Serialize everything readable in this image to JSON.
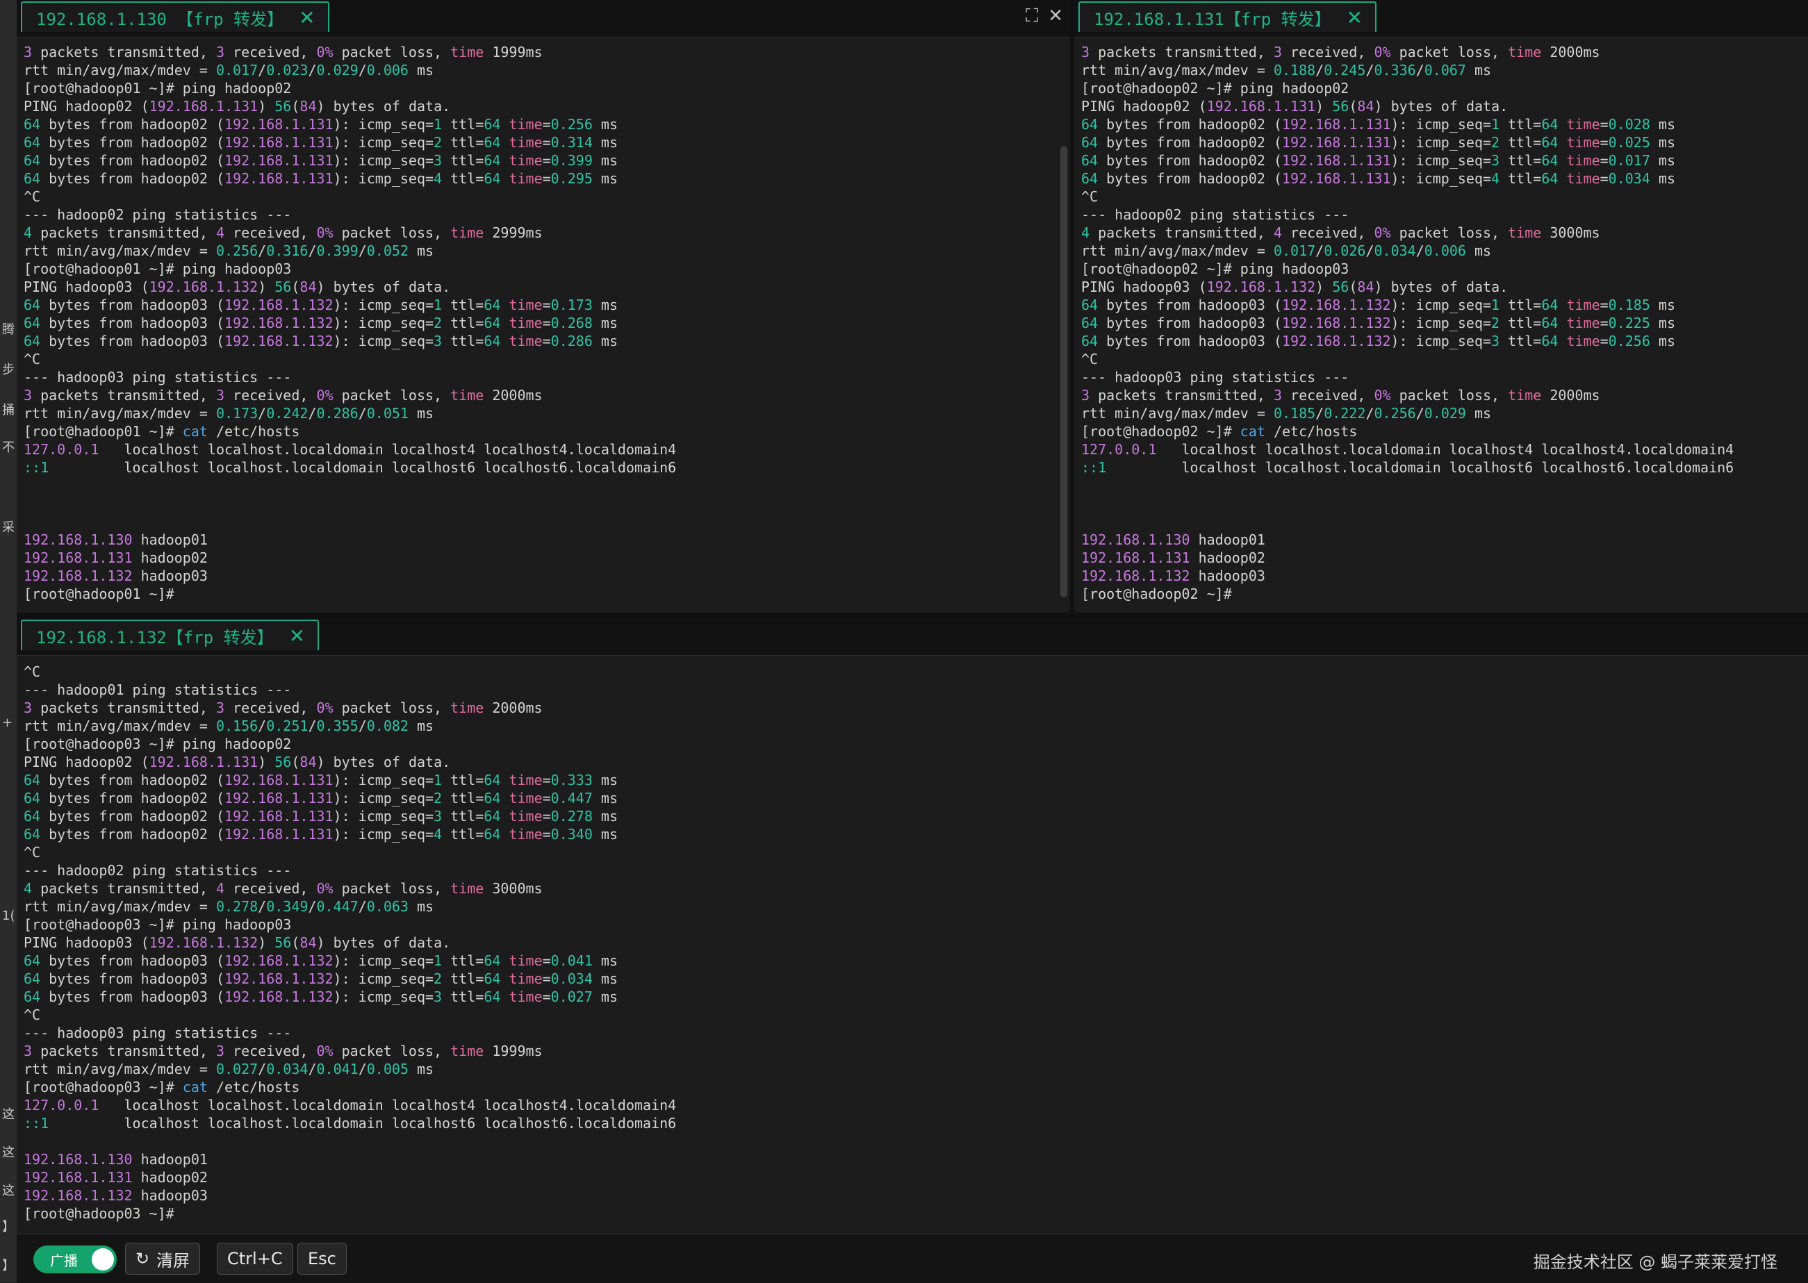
{
  "left_strip": [
    "腾",
    "步",
    "捅",
    "不",
    "采",
    "+",
    "1(",
    "这",
    "这",
    "这",
    "】",
    "】"
  ],
  "panes": {
    "p1": {
      "tab_title": "192.168.1.130 【frp 转发】",
      "close_glyph": "✕",
      "lines": [
        "[[p:3]] packets transmitted, [[p:3]] received, [[p:0%]] packet loss, [[r:time]] 1999ms",
        "rtt min/avg/max/mdev = [[g:0.017]]/[[g:0.023]]/[[g:0.029]]/[[g:0.006]] ms",
        "[root@hadoop01 ~]# ping hadoop02",
        "PING hadoop02 ([[p:192.168.1.131]]) [[g:56]]([[p:84]]) bytes of data.",
        "[[g:64]] bytes from hadoop02 ([[p:192.168.1.131]]): icmp_seq=[[g:1]] ttl=[[g:64]] [[r:time]]=[[g:0.256]] ms",
        "[[g:64]] bytes from hadoop02 ([[p:192.168.1.131]]): icmp_seq=[[g:2]] ttl=[[g:64]] [[r:time]]=[[g:0.314]] ms",
        "[[g:64]] bytes from hadoop02 ([[p:192.168.1.131]]): icmp_seq=[[g:3]] ttl=[[g:64]] [[r:time]]=[[g:0.399]] ms",
        "[[g:64]] bytes from hadoop02 ([[p:192.168.1.131]]): icmp_seq=[[g:4]] ttl=[[g:64]] [[r:time]]=[[g:0.295]] ms",
        "^C",
        "--- hadoop02 ping statistics ---",
        "[[g:4]] packets transmitted, [[p:4]] received, [[p:0%]] packet loss, [[r:time]] 2999ms",
        "rtt min/avg/max/mdev = [[g:0.256]]/[[g:0.316]]/[[g:0.399]]/[[g:0.052]] ms",
        "[root@hadoop01 ~]# ping hadoop03",
        "PING hadoop03 ([[p:192.168.1.132]]) [[g:56]]([[p:84]]) bytes of data.",
        "[[g:64]] bytes from hadoop03 ([[p:192.168.1.132]]): icmp_seq=[[g:1]] ttl=[[g:64]] [[r:time]]=[[g:0.173]] ms",
        "[[g:64]] bytes from hadoop03 ([[p:192.168.1.132]]): icmp_seq=[[g:2]] ttl=[[g:64]] [[r:time]]=[[g:0.268]] ms",
        "[[g:64]] bytes from hadoop03 ([[p:192.168.1.132]]): icmp_seq=[[g:3]] ttl=[[g:64]] [[r:time]]=[[g:0.286]] ms",
        "^C",
        "--- hadoop03 ping statistics ---",
        "[[p:3]] packets transmitted, [[p:3]] received, [[p:0%]] packet loss, [[r:time]] 2000ms",
        "rtt min/avg/max/mdev = [[g:0.173]]/[[g:0.242]]/[[g:0.286]]/[[g:0.051]] ms",
        "[root@hadoop01 ~]# [[b:cat]] /etc/hosts",
        "[[p:127.0.0.1]]   localhost localhost.localdomain localhost4 localhost4.localdomain4",
        "[[g:::1]]         localhost localhost.localdomain localhost6 localhost6.localdomain6",
        "",
        "",
        "",
        "[[p:192.168.1.130]] hadoop01",
        "[[p:192.168.1.131]] hadoop02",
        "[[p:192.168.1.132]] hadoop03",
        "[root@hadoop01 ~]#"
      ]
    },
    "p2": {
      "tab_title": "192.168.1.131【frp 转发】",
      "close_glyph": "✕",
      "lines": [
        "[[p:3]] packets transmitted, [[p:3]] received, [[p:0%]] packet loss, [[r:time]] 2000ms",
        "rtt min/avg/max/mdev = [[g:0.188]]/[[g:0.245]]/[[g:0.336]]/[[g:0.067]] ms",
        "[root@hadoop02 ~]# ping hadoop02",
        "PING hadoop02 ([[p:192.168.1.131]]) [[g:56]]([[p:84]]) bytes of data.",
        "[[g:64]] bytes from hadoop02 ([[p:192.168.1.131]]): icmp_seq=[[g:1]] ttl=[[g:64]] [[r:time]]=[[g:0.028]] ms",
        "[[g:64]] bytes from hadoop02 ([[p:192.168.1.131]]): icmp_seq=[[g:2]] ttl=[[g:64]] [[r:time]]=[[g:0.025]] ms",
        "[[g:64]] bytes from hadoop02 ([[p:192.168.1.131]]): icmp_seq=[[g:3]] ttl=[[g:64]] [[r:time]]=[[g:0.017]] ms",
        "[[g:64]] bytes from hadoop02 ([[p:192.168.1.131]]): icmp_seq=[[g:4]] ttl=[[g:64]] [[r:time]]=[[g:0.034]] ms",
        "^C",
        "--- hadoop02 ping statistics ---",
        "[[g:4]] packets transmitted, [[p:4]] received, [[p:0%]] packet loss, [[r:time]] 3000ms",
        "rtt min/avg/max/mdev = [[g:0.017]]/[[g:0.026]]/[[g:0.034]]/[[g:0.006]] ms",
        "[root@hadoop02 ~]# ping hadoop03",
        "PING hadoop03 ([[p:192.168.1.132]]) [[g:56]]([[p:84]]) bytes of data.",
        "[[g:64]] bytes from hadoop03 ([[p:192.168.1.132]]): icmp_seq=[[g:1]] ttl=[[g:64]] [[r:time]]=[[g:0.185]] ms",
        "[[g:64]] bytes from hadoop03 ([[p:192.168.1.132]]): icmp_seq=[[g:2]] ttl=[[g:64]] [[r:time]]=[[g:0.225]] ms",
        "[[g:64]] bytes from hadoop03 ([[p:192.168.1.132]]): icmp_seq=[[g:3]] ttl=[[g:64]] [[r:time]]=[[g:0.256]] ms",
        "^C",
        "--- hadoop03 ping statistics ---",
        "[[p:3]] packets transmitted, [[p:3]] received, [[p:0%]] packet loss, [[r:time]] 2000ms",
        "rtt min/avg/max/mdev = [[g:0.185]]/[[g:0.222]]/[[g:0.256]]/[[g:0.029]] ms",
        "[root@hadoop02 ~]# [[b:cat]] /etc/hosts",
        "[[p:127.0.0.1]]   localhost localhost.localdomain localhost4 localhost4.localdomain4",
        "[[g:::1]]         localhost localhost.localdomain localhost6 localhost6.localdomain6",
        "",
        "",
        "",
        "[[p:192.168.1.130]] hadoop01",
        "[[p:192.168.1.131]] hadoop02",
        "[[p:192.168.1.132]] hadoop03",
        "[root@hadoop02 ~]#"
      ]
    },
    "p3": {
      "tab_title": "192.168.1.132【frp 转发】",
      "close_glyph": "✕",
      "lines": [
        "^C",
        "--- hadoop01 ping statistics ---",
        "[[p:3]] packets transmitted, [[p:3]] received, [[p:0%]] packet loss, [[r:time]] 2000ms",
        "rtt min/avg/max/mdev = [[g:0.156]]/[[g:0.251]]/[[g:0.355]]/[[g:0.082]] ms",
        "[root@hadoop03 ~]# ping hadoop02",
        "PING hadoop02 ([[p:192.168.1.131]]) [[g:56]]([[p:84]]) bytes of data.",
        "[[g:64]] bytes from hadoop02 ([[p:192.168.1.131]]): icmp_seq=[[g:1]] ttl=[[g:64]] [[r:time]]=[[g:0.333]] ms",
        "[[g:64]] bytes from hadoop02 ([[p:192.168.1.131]]): icmp_seq=[[g:2]] ttl=[[g:64]] [[r:time]]=[[g:0.447]] ms",
        "[[g:64]] bytes from hadoop02 ([[p:192.168.1.131]]): icmp_seq=[[g:3]] ttl=[[g:64]] [[r:time]]=[[g:0.278]] ms",
        "[[g:64]] bytes from hadoop02 ([[p:192.168.1.131]]): icmp_seq=[[g:4]] ttl=[[g:64]] [[r:time]]=[[g:0.340]] ms",
        "^C",
        "--- hadoop02 ping statistics ---",
        "[[g:4]] packets transmitted, [[p:4]] received, [[p:0%]] packet loss, [[r:time]] 3000ms",
        "rtt min/avg/max/mdev = [[g:0.278]]/[[g:0.349]]/[[g:0.447]]/[[g:0.063]] ms",
        "[root@hadoop03 ~]# ping hadoop03",
        "PING hadoop03 ([[p:192.168.1.132]]) [[g:56]]([[p:84]]) bytes of data.",
        "[[g:64]] bytes from hadoop03 ([[p:192.168.1.132]]): icmp_seq=[[g:1]] ttl=[[g:64]] [[r:time]]=[[g:0.041]] ms",
        "[[g:64]] bytes from hadoop03 ([[p:192.168.1.132]]): icmp_seq=[[g:2]] ttl=[[g:64]] [[r:time]]=[[g:0.034]] ms",
        "[[g:64]] bytes from hadoop03 ([[p:192.168.1.132]]): icmp_seq=[[g:3]] ttl=[[g:64]] [[r:time]]=[[g:0.027]] ms",
        "^C",
        "--- hadoop03 ping statistics ---",
        "[[p:3]] packets transmitted, [[p:3]] received, [[p:0%]] packet loss, [[r:time]] 1999ms",
        "rtt min/avg/max/mdev = [[g:0.027]]/[[g:0.034]]/[[g:0.041]]/[[g:0.005]] ms",
        "[root@hadoop03 ~]# [[b:cat]] /etc/hosts",
        "[[p:127.0.0.1]]   localhost localhost.localdomain localhost4 localhost4.localdomain4",
        "[[g:::1]]         localhost localhost.localdomain localhost6 localhost6.localdomain6",
        "",
        "[[p:192.168.1.130]] hadoop01",
        "[[p:192.168.1.131]] hadoop02",
        "[[p:192.168.1.132]] hadoop03",
        "[root@hadoop03 ~]#"
      ]
    }
  },
  "pane_actions": {
    "expand_glyph": "⛶",
    "close_glyph": "✕"
  },
  "bottom_bar": {
    "broadcast_label": "广播",
    "broadcast_on": true,
    "refresh_glyph": "↻",
    "clear_label": "清屏",
    "ctrlc_label": "Ctrl+C",
    "esc_label": "Esc"
  },
  "watermark": "掘金技术社区 @ 蝎子莱莱爱打怪",
  "colors": {
    "accent": "#20b388",
    "ip_purple": "#c678dd",
    "number_teal": "#2ec4a6",
    "keyword_pink": "#e06c9a",
    "command_blue": "#4fa6e8",
    "toggle_green": "#14a36c"
  }
}
